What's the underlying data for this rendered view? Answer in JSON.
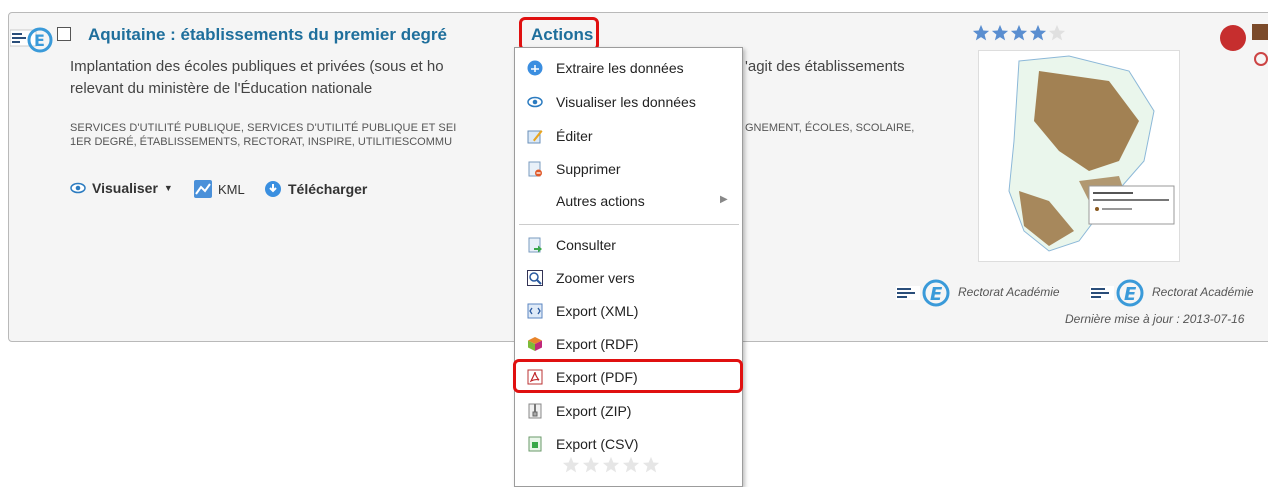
{
  "record": {
    "title": "Aquitaine : établissements du premier degré",
    "actions_label": "Actions",
    "description_line1_left": "Implantation des écoles publiques et privées (sous et ho",
    "description_line1_right": "'agit des établissements",
    "description_line2": "relevant du ministère de l'Éducation nationale",
    "keywords_line1_left": "SERVICES D'UTILITÉ PUBLIQUE, SERVICES D'UTILITÉ PUBLIQUE ET SEI",
    "keywords_line1_right": "GNEMENT, ÉCOLES, SCOLAIRE,",
    "keywords_line2": "1ER DEGRÉ, ÉTABLISSEMENTS, RECTORAT, INSPIRE, UTILITIESCOMMU",
    "tools": {
      "visualiser": "Visualiser",
      "kml": "KML",
      "telecharger": "Télécharger"
    },
    "rating": 4,
    "organizations": [
      "Rectorat Académie",
      "Rectorat Académie"
    ],
    "last_update": "Dernière mise à jour : 2013-07-16"
  },
  "menu": {
    "items": [
      {
        "label": "Extraire les données",
        "icon": "extract-icon"
      },
      {
        "label": "Visualiser les données",
        "icon": "eye-icon"
      },
      {
        "label": "Éditer",
        "icon": "edit-icon"
      },
      {
        "label": "Supprimer",
        "icon": "delete-icon"
      },
      {
        "label": "Autres actions",
        "icon": "submenu-arrow-icon"
      },
      {
        "label": "Consulter",
        "icon": "consult-icon"
      },
      {
        "label": "Zoomer vers",
        "icon": "zoom-icon"
      },
      {
        "label": "Export (XML)",
        "icon": "xml-icon"
      },
      {
        "label": "Export (RDF)",
        "icon": "rdf-icon"
      },
      {
        "label": "Export (PDF)",
        "icon": "pdf-icon"
      },
      {
        "label": "Export (ZIP)",
        "icon": "zip-icon"
      },
      {
        "label": "Export (CSV)",
        "icon": "csv-icon"
      }
    ]
  },
  "colors": {
    "title_blue": "#1f6f9c",
    "highlight_red": "#e01010",
    "star_blue": "#5a8ed0"
  }
}
